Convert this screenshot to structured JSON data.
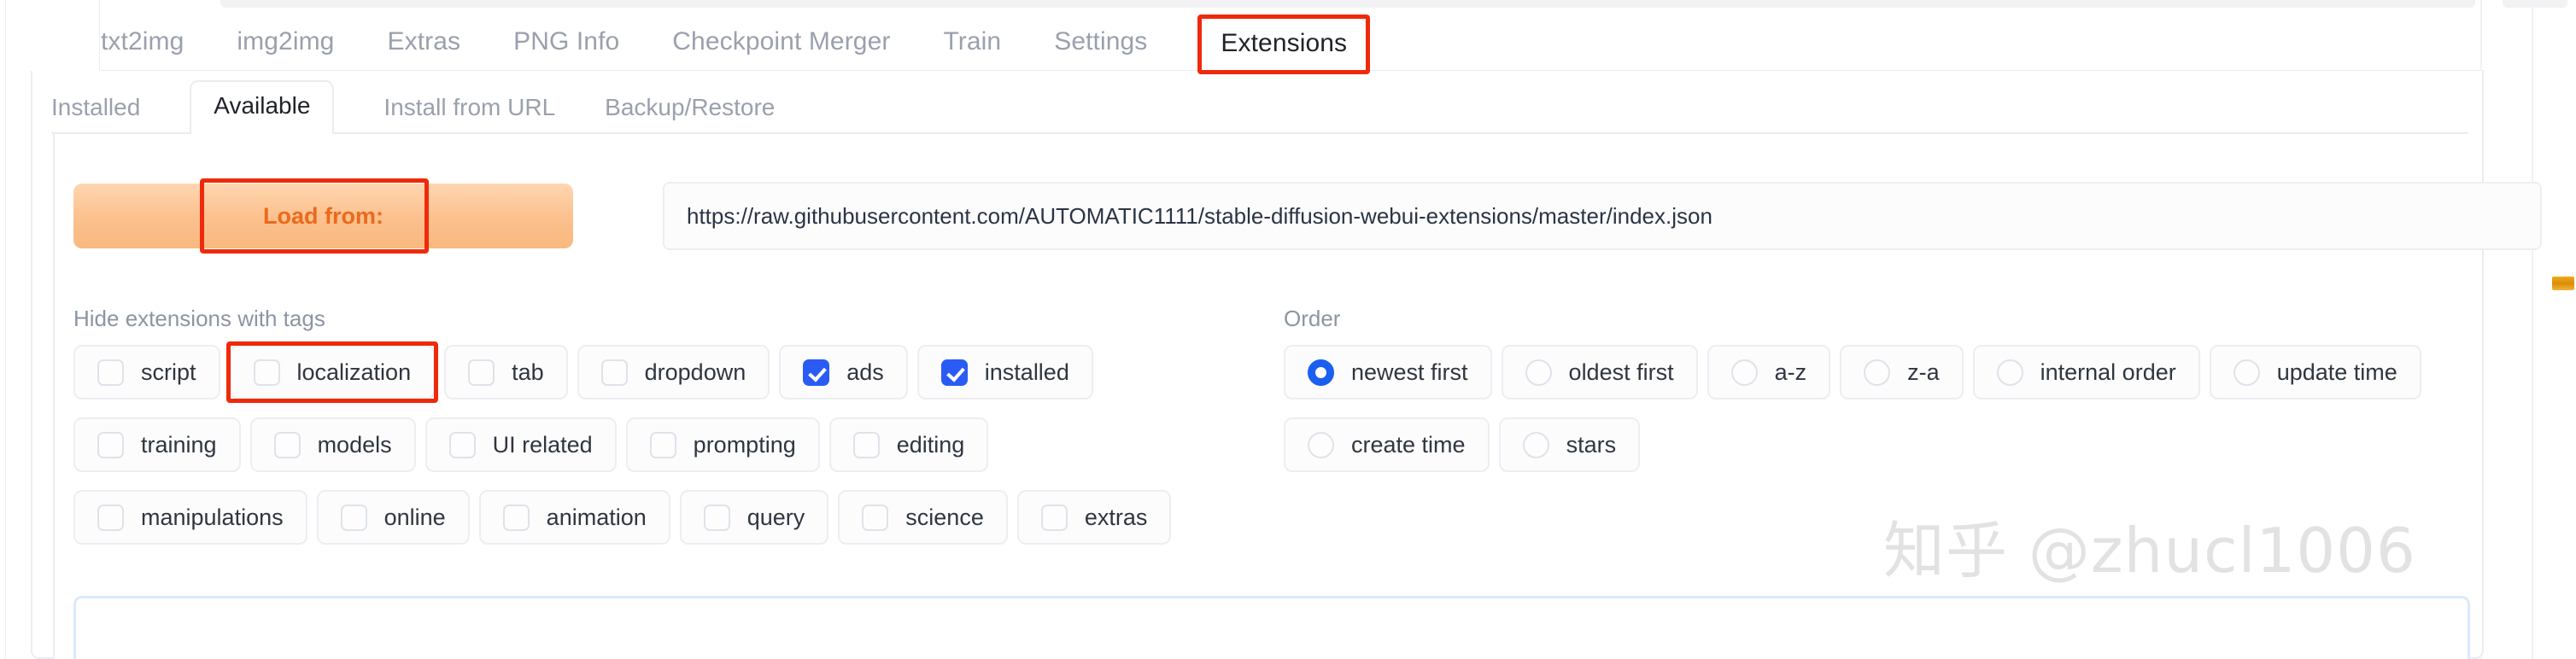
{
  "main_tabs": [
    {
      "label": "txt2img",
      "active": false
    },
    {
      "label": "img2img",
      "active": false
    },
    {
      "label": "Extras",
      "active": false
    },
    {
      "label": "PNG Info",
      "active": false
    },
    {
      "label": "Checkpoint Merger",
      "active": false
    },
    {
      "label": "Train",
      "active": false
    },
    {
      "label": "Settings",
      "active": false
    },
    {
      "label": "Extensions",
      "active": true,
      "highlighted": true
    }
  ],
  "sub_tabs": [
    {
      "label": "Installed",
      "active": false
    },
    {
      "label": "Available",
      "active": true
    },
    {
      "label": "Install from URL",
      "active": false
    },
    {
      "label": "Backup/Restore",
      "active": false
    }
  ],
  "load_row": {
    "button_label": "Load from:",
    "button_highlighted": true,
    "url_value": "https://raw.githubusercontent.com/AUTOMATIC1111/stable-diffusion-webui-extensions/master/index.json"
  },
  "tags": {
    "label": "Hide extensions with tags",
    "rows": [
      [
        {
          "label": "script",
          "checked": false,
          "highlighted": false
        },
        {
          "label": "localization",
          "checked": false,
          "highlighted": true
        },
        {
          "label": "tab",
          "checked": false,
          "highlighted": false
        },
        {
          "label": "dropdown",
          "checked": false,
          "highlighted": false
        },
        {
          "label": "ads",
          "checked": true,
          "highlighted": false
        },
        {
          "label": "installed",
          "checked": true,
          "highlighted": false
        }
      ],
      [
        {
          "label": "training",
          "checked": false,
          "highlighted": false
        },
        {
          "label": "models",
          "checked": false,
          "highlighted": false
        },
        {
          "label": "UI related",
          "checked": false,
          "highlighted": false
        },
        {
          "label": "prompting",
          "checked": false,
          "highlighted": false
        },
        {
          "label": "editing",
          "checked": false,
          "highlighted": false
        }
      ],
      [
        {
          "label": "manipulations",
          "checked": false,
          "highlighted": false
        },
        {
          "label": "online",
          "checked": false,
          "highlighted": false
        },
        {
          "label": "animation",
          "checked": false,
          "highlighted": false
        },
        {
          "label": "query",
          "checked": false,
          "highlighted": false
        },
        {
          "label": "science",
          "checked": false,
          "highlighted": false
        },
        {
          "label": "extras",
          "checked": false,
          "highlighted": false
        }
      ]
    ]
  },
  "order": {
    "label": "Order",
    "rows": [
      [
        {
          "label": "newest first",
          "selected": true
        },
        {
          "label": "oldest first",
          "selected": false
        },
        {
          "label": "a-z",
          "selected": false
        },
        {
          "label": "z-a",
          "selected": false
        },
        {
          "label": "internal order",
          "selected": false
        },
        {
          "label": "update time",
          "selected": false
        }
      ],
      [
        {
          "label": "create time",
          "selected": false
        },
        {
          "label": "stars",
          "selected": false
        }
      ]
    ]
  },
  "watermark": {
    "text": "知乎 @zhucl1006"
  },
  "colors": {
    "accent_orange": "#ea6a1c",
    "highlight_red": "#ef2a0b",
    "checkbox_blue": "#2a5cf5",
    "radio_blue": "#1a5ff0",
    "results_border": "#dde8fb"
  }
}
